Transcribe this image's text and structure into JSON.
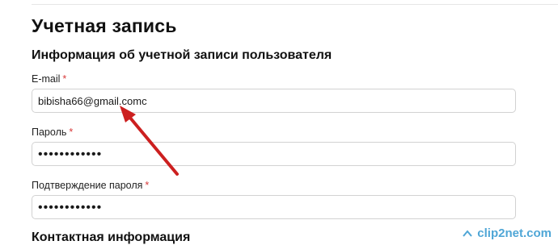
{
  "page": {
    "title": "Учетная запись",
    "section_title": "Информация об учетной записи пользователя",
    "next_section_title": "Контактная информация"
  },
  "form": {
    "required_marker": "*",
    "email": {
      "label": "E-mail",
      "value": "bibisha66@gmail.comc"
    },
    "password": {
      "label": "Пароль",
      "value": "••••••••••••"
    },
    "password_confirm": {
      "label": "Подтверждение пароля",
      "value": "••••••••••••"
    }
  },
  "annotation": {
    "arrow_color": "#cc1f1f",
    "arrow_icon": "arrow-icon"
  },
  "watermark": {
    "text": "clip2net.com",
    "color": "#4fa6d6"
  }
}
